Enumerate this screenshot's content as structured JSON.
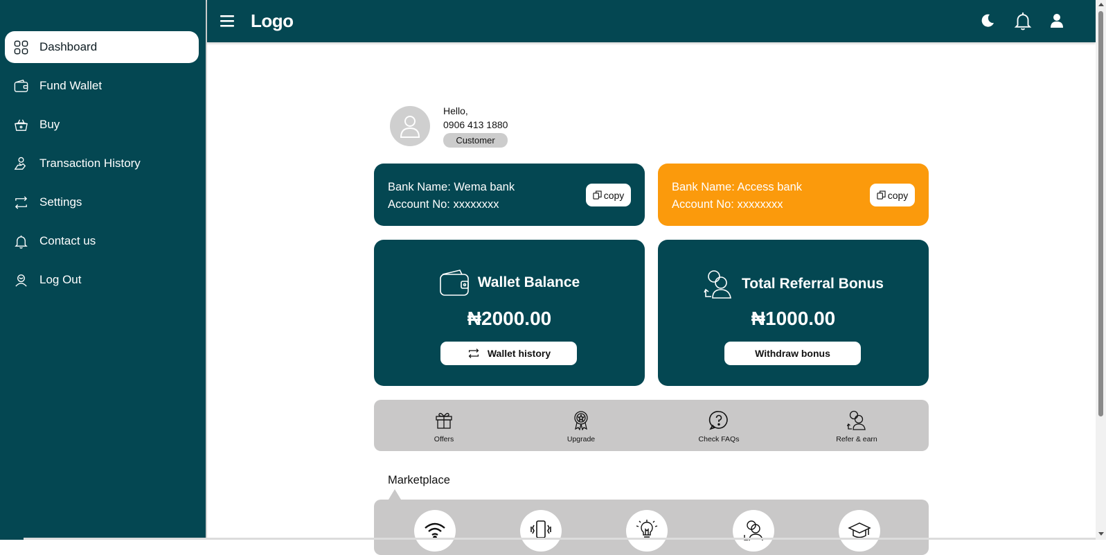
{
  "topbar": {
    "logo": "Logo",
    "icons": [
      "menu-icon",
      "moon-icon",
      "bell-icon",
      "user-icon"
    ]
  },
  "sidebar": {
    "items": [
      {
        "label": "Dashboard",
        "icon": "grid-icon",
        "active": true
      },
      {
        "label": "Fund Wallet",
        "icon": "wallet-icon",
        "active": false
      },
      {
        "label": "Buy",
        "icon": "basket-icon",
        "active": false
      },
      {
        "label": "Transaction History",
        "icon": "hand-coin-icon",
        "active": false
      },
      {
        "label": "Settings",
        "icon": "exchange-icon",
        "active": false
      },
      {
        "label": "Contact us",
        "icon": "bell-icon",
        "active": false
      },
      {
        "label": "Log Out",
        "icon": "user-out-icon",
        "active": false
      }
    ]
  },
  "profile": {
    "greeting": "Hello,",
    "phone": "0906 413 1880",
    "role": "Customer"
  },
  "banks": [
    {
      "name": "Bank Name: Wema bank",
      "account": "Account No: xxxxxxxx",
      "copy_label": "copy",
      "color": "#044752"
    },
    {
      "name": "Bank Name: Access bank",
      "account": "Account No: xxxxxxxx",
      "copy_label": "copy",
      "color": "#fb9a0c"
    }
  ],
  "wallet": {
    "title": "Wallet Balance",
    "amount": "₦2000.00",
    "button": "Wallet history"
  },
  "referral": {
    "title": "Total Referral Bonus",
    "amount": "₦1000.00",
    "button": "Withdraw bonus"
  },
  "quick_links": [
    {
      "label": "Offers",
      "icon": "gift-icon"
    },
    {
      "label": "Upgrade",
      "icon": "award-icon"
    },
    {
      "label": "Check FAQs",
      "icon": "question-icon"
    },
    {
      "label": "Refer & earn",
      "icon": "refer-icon"
    }
  ],
  "marketplace": {
    "title": "Marketplace",
    "items": [
      "wifi-icon",
      "phone-vibrate-icon",
      "bulb-icon",
      "person-icon",
      "graduation-cap-icon"
    ]
  },
  "colors": {
    "primary": "#044752",
    "accent": "#fb9a0c",
    "panel": "#c9c8c8"
  }
}
